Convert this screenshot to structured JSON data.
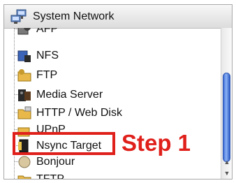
{
  "window": {
    "title": "System Network"
  },
  "tree": {
    "items": [
      {
        "label": "AFP",
        "icon": "afp-icon"
      },
      {
        "label": "NFS",
        "icon": "nfs-icon"
      },
      {
        "label": "FTP",
        "icon": "ftp-icon"
      },
      {
        "label": "Media Server",
        "icon": "media-server-icon"
      },
      {
        "label": "HTTP / Web Disk",
        "icon": "http-web-disk-icon"
      },
      {
        "label": "UPnP",
        "icon": "upnp-icon"
      },
      {
        "label": "Nsync Target",
        "icon": "nsync-target-icon"
      },
      {
        "label": "Bonjour",
        "icon": "bonjour-icon"
      },
      {
        "label": "TFTP",
        "icon": "tftp-icon"
      }
    ]
  },
  "annotation": {
    "text": "Step 1",
    "color": "#e0201b"
  },
  "scrollbar": {
    "thumb_color": "#4a7be0",
    "up_glyph": "▲",
    "down_glyph": "▼"
  }
}
